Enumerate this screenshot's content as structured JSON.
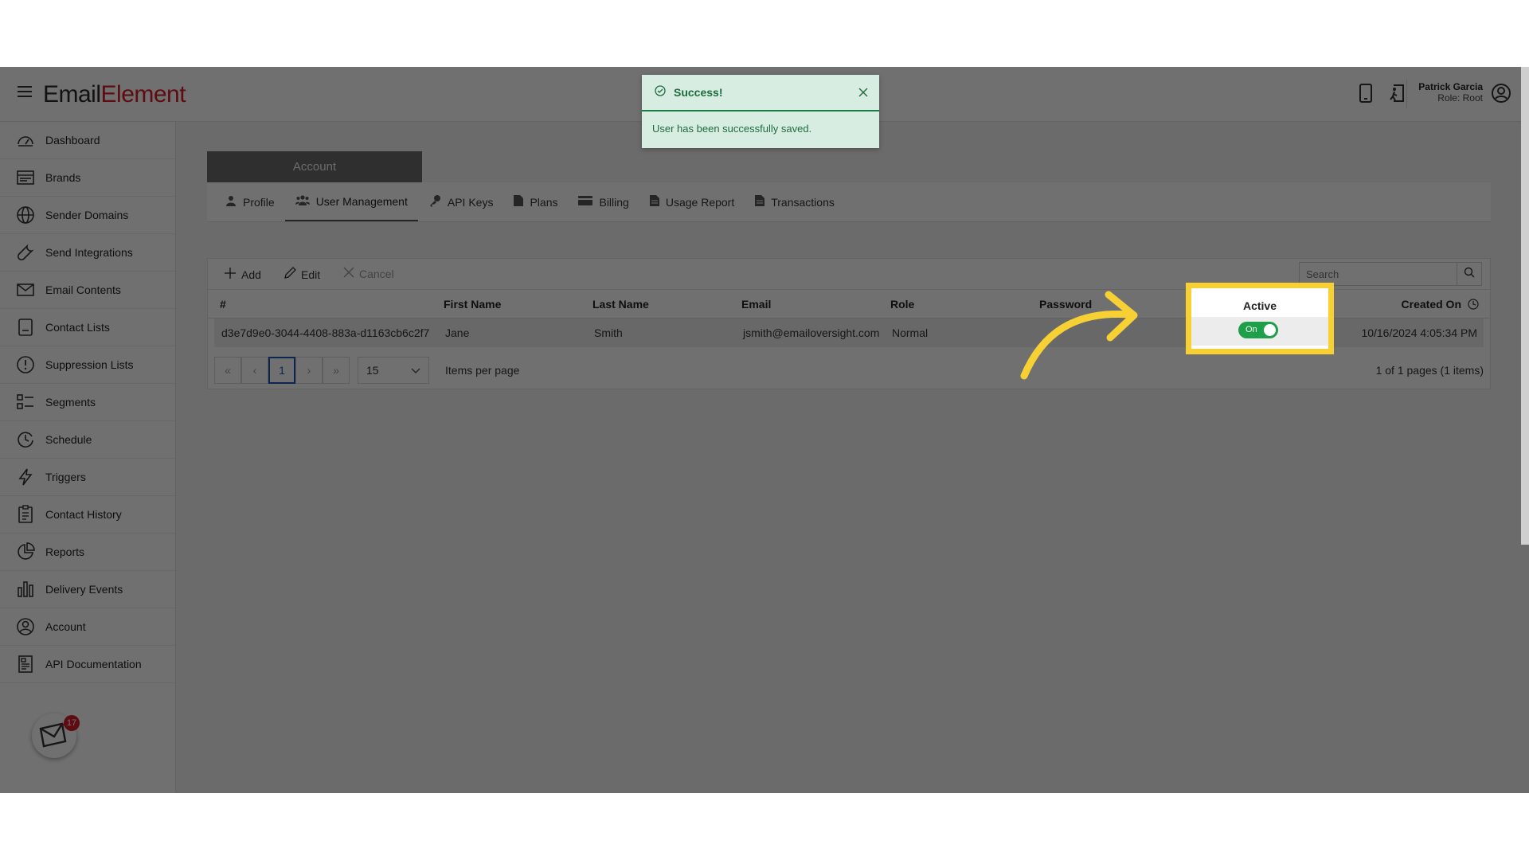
{
  "brand": {
    "logo_part1": "Em",
    "logo_part2": "ail",
    "logo_part3": "Element"
  },
  "user": {
    "name": "Patrick Garcia",
    "role": "Role: Root"
  },
  "sidebar": {
    "items": [
      {
        "label": "Dashboard",
        "icon": "gauge-icon"
      },
      {
        "label": "Brands",
        "icon": "layers-icon"
      },
      {
        "label": "Sender Domains",
        "icon": "globe-icon"
      },
      {
        "label": "Send Integrations",
        "icon": "wrench-icon"
      },
      {
        "label": "Email Contents",
        "icon": "envelope-icon"
      },
      {
        "label": "Contact Lists",
        "icon": "list-icon"
      },
      {
        "label": "Suppression Lists",
        "icon": "alert-circle-icon"
      },
      {
        "label": "Segments",
        "icon": "segments-icon"
      },
      {
        "label": "Schedule",
        "icon": "clock-icon"
      },
      {
        "label": "Triggers",
        "icon": "bolt-icon"
      },
      {
        "label": "Contact History",
        "icon": "clipboard-icon"
      },
      {
        "label": "Reports",
        "icon": "pie-chart-icon"
      },
      {
        "label": "Delivery Events",
        "icon": "bar-chart-icon"
      },
      {
        "label": "Account",
        "icon": "user-circle-icon"
      },
      {
        "label": "API Documentation",
        "icon": "document-icon"
      }
    ],
    "notification_count": "17"
  },
  "account": {
    "header": "Account",
    "tabs": [
      {
        "label": "Profile",
        "icon": "user-icon"
      },
      {
        "label": "User Management",
        "icon": "users-icon"
      },
      {
        "label": "API Keys",
        "icon": "key-icon"
      },
      {
        "label": "Plans",
        "icon": "file-icon"
      },
      {
        "label": "Billing",
        "icon": "credit-card-icon"
      },
      {
        "label": "Usage Report",
        "icon": "file-icon"
      },
      {
        "label": "Transactions",
        "icon": "file-icon"
      }
    ]
  },
  "grid": {
    "toolbar": {
      "add": "Add",
      "edit": "Edit",
      "cancel": "Cancel",
      "search_placeholder": "Search"
    },
    "columns": [
      "#",
      "First Name",
      "Last Name",
      "Email",
      "Role",
      "Password",
      "Active",
      "Created On"
    ],
    "row": {
      "id": "d3e7d9e0-3044-4408-883a-d1163cb6c2f7",
      "first_name": "Jane",
      "last_name": "Smith",
      "email": "jsmith@emailoversight.com",
      "role": "Normal",
      "password": "",
      "active_label": "On",
      "created_on": "10/16/2024 4:05:34 PM"
    },
    "pager": {
      "first": "«",
      "prev": "‹",
      "current_page": "1",
      "next": "›",
      "last": "»",
      "page_size": "15",
      "items_per_page_label": "Items per page",
      "info": "1 of 1 pages (1 items)"
    }
  },
  "toast": {
    "title": "Success!",
    "message": "User has been successfully saved."
  },
  "colors": {
    "brand_red": "#d31f2a",
    "toggle_green": "#1e9f49",
    "highlight_yellow": "#f7d033",
    "toast_green": "#1e6b3e"
  }
}
